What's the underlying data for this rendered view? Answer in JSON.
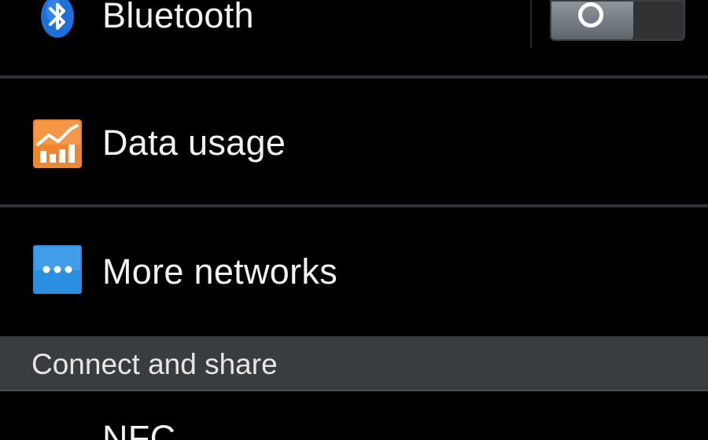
{
  "network_settings": {
    "bluetooth": {
      "label": "Bluetooth",
      "icon": "bluetooth-icon",
      "icon_color": "#1e6fd9",
      "toggle_state": "off"
    },
    "data_usage": {
      "label": "Data usage",
      "icon": "data-usage-chart-icon",
      "icon_color": "#f0852f"
    },
    "more_networks": {
      "label": "More networks",
      "icon": "more-networks-dots-icon",
      "icon_color": "#2a8fe0"
    }
  },
  "connect_and_share": {
    "header": "Connect and share",
    "nfc": {
      "label": "NFC"
    }
  },
  "colors": {
    "background": "#000000",
    "divider": "#2f3133",
    "section_header_bg": "#3a3d40",
    "text_primary": "#f2f2f2"
  }
}
